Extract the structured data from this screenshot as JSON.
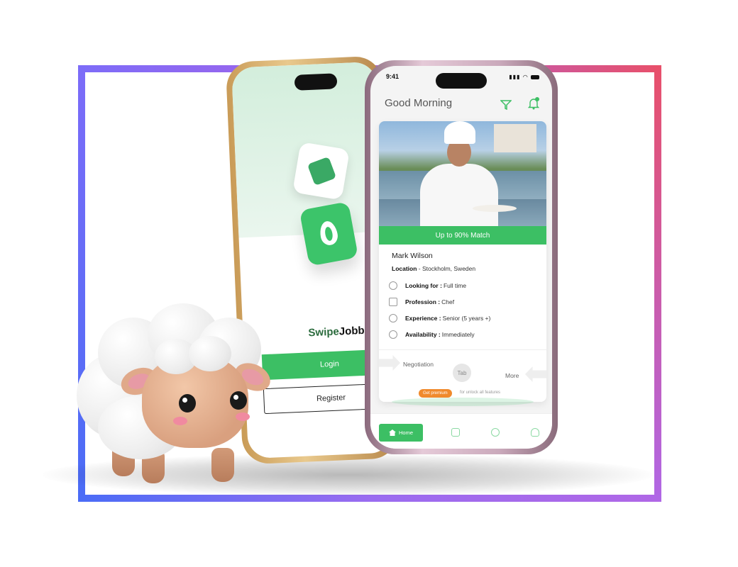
{
  "login_screen": {
    "brand_part1": "Swipe",
    "brand_part2": "Jobb",
    "login_label": "Login",
    "register_label": "Register"
  },
  "home_screen": {
    "status_time": "9:41",
    "greeting": "Good Morning",
    "match_label": "Up to 90% Match",
    "candidate_name": "Mark Wilson",
    "location_label": "Location",
    "location_value": " - Stockholm, Sweden",
    "details": [
      {
        "icon": "search-icon",
        "label": "Looking for :",
        "value": "Full time"
      },
      {
        "icon": "briefcase-icon",
        "label": "Profession :",
        "value": "Chef"
      },
      {
        "icon": "experience-icon",
        "label": "Experience :",
        "value": "Senior (5 years +)"
      },
      {
        "icon": "availability-icon",
        "label": "Availability :",
        "value": "Immediately"
      }
    ],
    "swipe_left_label": "Negotiation",
    "tab_label": "Tab",
    "swipe_right_label": "More",
    "premium_label": "Get premium",
    "premium_hint": "for unlock all features",
    "nav": {
      "home_label": "Home"
    },
    "accent_color": "#3cbf64",
    "premium_color": "#f08a2c"
  }
}
